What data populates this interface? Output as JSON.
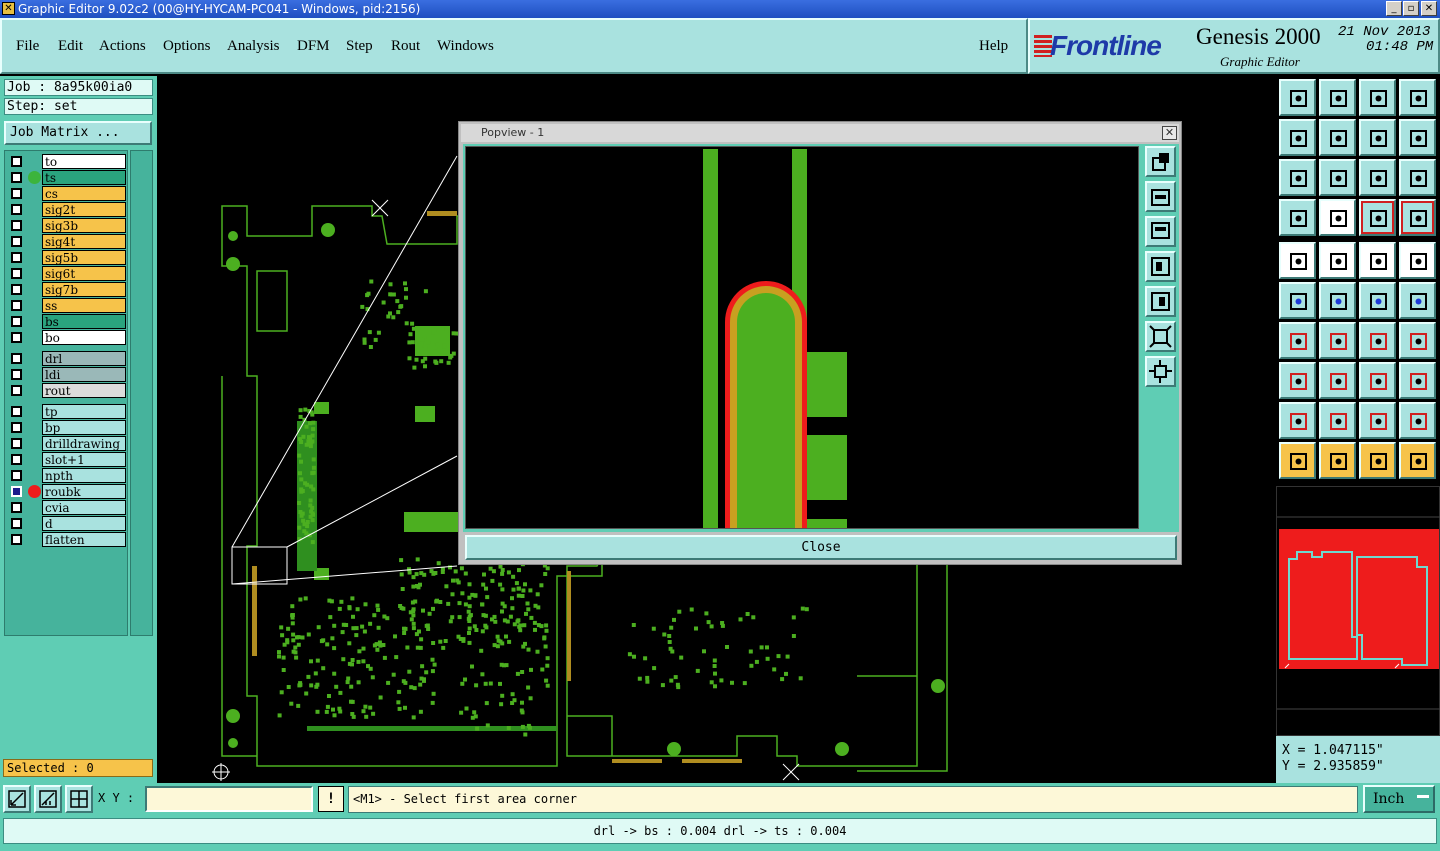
{
  "window": {
    "title": "Graphic Editor 9.02c2 (00@HY-HYCAM-PC041 - Windows, pid:2156)"
  },
  "menu": {
    "items": [
      "File",
      "Edit",
      "Actions",
      "Options",
      "Analysis",
      "DFM",
      "Step",
      "Rout",
      "Windows"
    ],
    "help": "Help"
  },
  "brand": {
    "logo": "Frontline",
    "product": "Genesis 2000",
    "subtitle": "Graphic Editor",
    "date": "21 Nov 2013",
    "time": "01:48 PM"
  },
  "job": {
    "job_label": "Job : 8a95k00ia0",
    "step_label": "Step: set",
    "matrix_button": "Job Matrix ..."
  },
  "layers": {
    "group1": [
      {
        "name": "to",
        "color": "#ffffff",
        "dot": ""
      },
      {
        "name": "ts",
        "color": "#2aa47e",
        "dot": "#3cb43c"
      },
      {
        "name": "cs",
        "color": "#f6c34a",
        "dot": ""
      },
      {
        "name": "sig2t",
        "color": "#f6c34a",
        "dot": ""
      },
      {
        "name": "sig3b",
        "color": "#f6c34a",
        "dot": ""
      },
      {
        "name": "sig4t",
        "color": "#f6c34a",
        "dot": ""
      },
      {
        "name": "sig5b",
        "color": "#f6c34a",
        "dot": ""
      },
      {
        "name": "sig6t",
        "color": "#f6c34a",
        "dot": ""
      },
      {
        "name": "sig7b",
        "color": "#f6c34a",
        "dot": ""
      },
      {
        "name": "ss",
        "color": "#f6c34a",
        "dot": ""
      },
      {
        "name": "bs",
        "color": "#2aa47e",
        "dot": ""
      },
      {
        "name": "bo",
        "color": "#ffffff",
        "dot": ""
      }
    ],
    "group2": [
      {
        "name": "drl",
        "color": "#9ab8b8",
        "dot": ""
      },
      {
        "name": "ldi",
        "color": "#9ab8b8",
        "dot": ""
      },
      {
        "name": "rout",
        "color": "#dcdcdc",
        "dot": ""
      }
    ],
    "group3": [
      {
        "name": "tp",
        "color": "#a9e2df",
        "dot": ""
      },
      {
        "name": "bp",
        "color": "#a9e2df",
        "dot": ""
      },
      {
        "name": "drilldrawing",
        "color": "#a9e2df",
        "dot": ""
      },
      {
        "name": "slot+1",
        "color": "#a9e2df",
        "dot": ""
      },
      {
        "name": "npth",
        "color": "#a9e2df",
        "dot": ""
      },
      {
        "name": "roubk",
        "color": "#a9e2df",
        "dot": "#ee1c1c",
        "checked": true
      },
      {
        "name": "cvia",
        "color": "#a9e2df",
        "dot": ""
      },
      {
        "name": "d",
        "color": "#a9e2df",
        "dot": ""
      },
      {
        "name": "flatten",
        "color": "#a9e2df",
        "dot": ""
      }
    ]
  },
  "selected": "Selected : 0",
  "popview": {
    "title": "Popview - 1",
    "close": "Close"
  },
  "coords": {
    "x": "X = 1.047115\"",
    "y": "Y = 2.935859\""
  },
  "command": {
    "xy_label": "X Y :",
    "xy_value": "",
    "excl": "!",
    "prompt": "<M1> - Select first area corner",
    "units": "Inch"
  },
  "status": "drl -> bs : 0.004   drl -> ts : 0.004"
}
